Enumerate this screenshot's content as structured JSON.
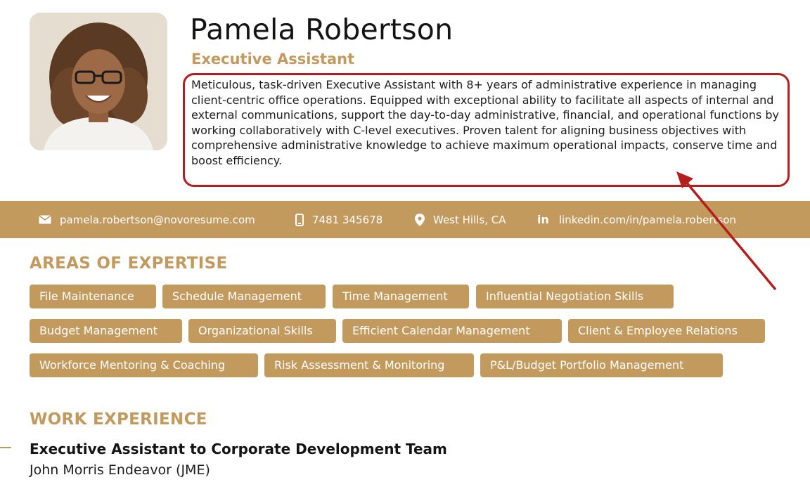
{
  "header": {
    "name": "Pamela Robertson",
    "title": "Executive Assistant",
    "summary": "Meticulous, task-driven Executive Assistant with 8+ years of administrative experience in managing client-centric office operations. Equipped with exceptional ability to facilitate all aspects of internal and external communications, support the day-to-day administrative, financial, and operational functions by working collaboratively with C-level executives. Proven talent for aligning business objectives with comprehensive administrative knowledge to achieve maximum operational impacts, conserve time and boost efficiency."
  },
  "contact": {
    "email": "pamela.robertson@novoresume.com",
    "phone": "7481 345678",
    "location": "West Hills, CA",
    "linkedin_icon_text": "in",
    "linkedin": "linkedin.com/in/pamela.robertson"
  },
  "expertise": {
    "heading": "AREAS OF EXPERTISE",
    "tags": [
      "File Maintenance",
      "Schedule Management",
      "Time Management",
      "Influential Negotiation Skills",
      "Budget Management",
      "Organizational Skills",
      "Efficient Calendar Management",
      "Client & Employee Relations",
      "Workforce Mentoring & Coaching",
      "Risk Assessment & Monitoring",
      "P&L/Budget Portfolio Management"
    ]
  },
  "work": {
    "heading": "WORK EXPERIENCE",
    "job_title": "Executive Assistant to Corporate Development Team",
    "company": "John Morris Endeavor (JME)"
  },
  "colors": {
    "accent": "#c29a5e",
    "annotation": "#b41e1e",
    "text": "#1c1c1c"
  },
  "icons": [
    "envelope-icon",
    "phone-icon",
    "location-pin-icon",
    "linkedin-icon"
  ]
}
